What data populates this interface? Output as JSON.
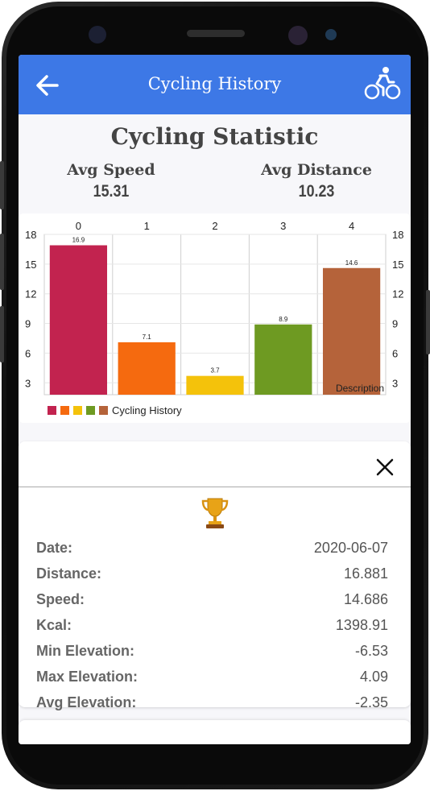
{
  "appbar": {
    "title": "Cycling History",
    "back_icon": "arrow-left-icon",
    "action_icon": "cyclist-icon",
    "color": "#3d78e6"
  },
  "stats": {
    "title": "Cycling Statistic",
    "avg_speed_label": "Avg Speed",
    "avg_speed_value": "15.31",
    "avg_distance_label": "Avg Distance",
    "avg_distance_value": "10.23"
  },
  "chart_data": {
    "type": "bar",
    "categories": [
      "0",
      "1",
      "2",
      "3",
      "4"
    ],
    "values": [
      16.9,
      7.1,
      3.7,
      8.9,
      14.6
    ],
    "value_labels": [
      "16.9",
      "7.1",
      "3.7",
      "8.9",
      "14.6"
    ],
    "colors": [
      "#c2234f",
      "#f56a0f",
      "#f4c20b",
      "#6e9a22",
      "#b5633a"
    ],
    "yticks": [
      "3",
      "6",
      "9",
      "12",
      "15",
      "18"
    ],
    "ylim": [
      1.8,
      18
    ],
    "description": "Description",
    "legend": "Cycling History",
    "legend_position": "bottom-left",
    "grid": true
  },
  "details": {
    "close_icon": "close-icon",
    "trophy_icon": "trophy-icon",
    "rows": [
      {
        "label": "Date:",
        "value": "2020-06-07"
      },
      {
        "label": "Distance:",
        "value": "16.881"
      },
      {
        "label": "Speed:",
        "value": "14.686"
      },
      {
        "label": "Kcal:",
        "value": "1398.91"
      },
      {
        "label": "Min Elevation:",
        "value": "-6.53"
      },
      {
        "label": "Max Elevation:",
        "value": "4.09"
      },
      {
        "label": "Avg Elevation:",
        "value": "-2.35"
      }
    ]
  }
}
